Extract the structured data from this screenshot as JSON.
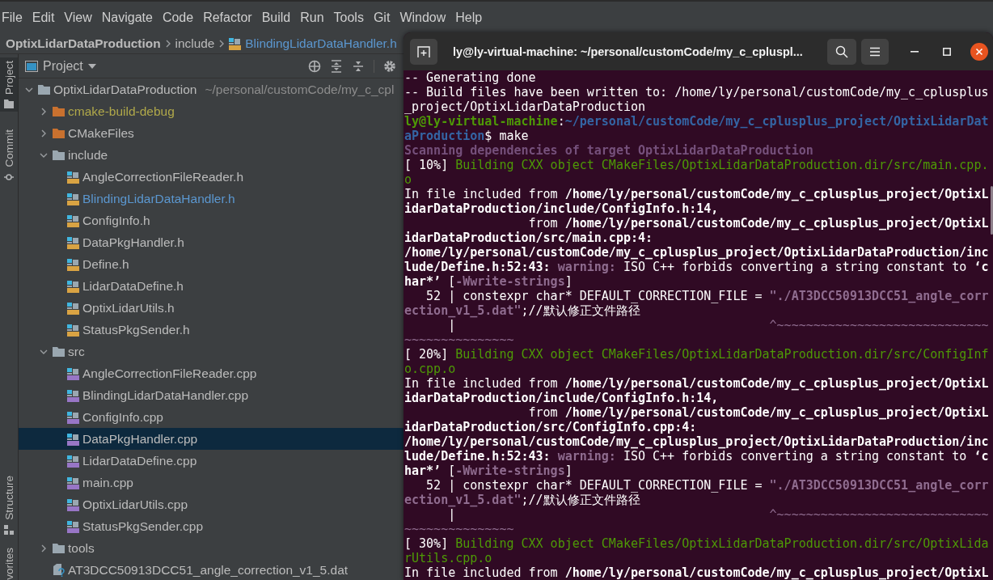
{
  "menu": [
    "File",
    "Edit",
    "View",
    "Navigate",
    "Code",
    "Refactor",
    "Build",
    "Run",
    "Tools",
    "Git",
    "Window",
    "Help"
  ],
  "breadcrumb": {
    "project": "OptixLidarDataProduction",
    "folder": "include",
    "file": "BlindingLidarDataHandler.h"
  },
  "tool_stripe": {
    "top": [
      {
        "label": "Project",
        "kind": "project",
        "selected": true
      },
      {
        "label": "Commit",
        "kind": "commit",
        "selected": false
      }
    ],
    "bottom": [
      {
        "label": "Structure",
        "kind": "structure",
        "selected": false
      },
      {
        "label": "vorites",
        "kind": "favorites",
        "selected": false
      }
    ]
  },
  "project_panel": {
    "title": "Project",
    "tree": [
      {
        "label": "OptixLidarDataProduction",
        "path": "~/personal/customCode/my_c_cpl",
        "kind": "folder",
        "color": "#9aa7b0",
        "excluded": false,
        "expanded": true,
        "selected": false,
        "children": [
          {
            "label": "cmake-build-debug",
            "kind": "folder",
            "color": "#c9712f",
            "excluded": true,
            "expanded": false,
            "selected": false
          },
          {
            "label": "CMakeFiles",
            "kind": "folder",
            "color": "#c9712f",
            "excluded": false,
            "expanded": false,
            "selected": false
          },
          {
            "label": "include",
            "kind": "folder",
            "color": "#9aa7b0",
            "excluded": false,
            "expanded": true,
            "selected": false,
            "children": [
              {
                "label": "AngleCorrectionFileReader.h",
                "kind": "header",
                "current": false,
                "selected": false
              },
              {
                "label": "BlindingLidarDataHandler.h",
                "kind": "header",
                "current": true,
                "selected": false
              },
              {
                "label": "ConfigInfo.h",
                "kind": "header",
                "current": false,
                "selected": false
              },
              {
                "label": "DataPkgHandler.h",
                "kind": "header",
                "current": false,
                "selected": false
              },
              {
                "label": "Define.h",
                "kind": "header",
                "current": false,
                "selected": false
              },
              {
                "label": "LidarDataDefine.h",
                "kind": "header",
                "current": false,
                "selected": false
              },
              {
                "label": "OptixLidarUtils.h",
                "kind": "header",
                "current": false,
                "selected": false
              },
              {
                "label": "StatusPkgSender.h",
                "kind": "header",
                "current": false,
                "selected": false
              }
            ]
          },
          {
            "label": "src",
            "kind": "folder",
            "color": "#9aa7b0",
            "excluded": false,
            "expanded": true,
            "selected": false,
            "children": [
              {
                "label": "AngleCorrectionFileReader.cpp",
                "kind": "source",
                "current": false,
                "selected": false
              },
              {
                "label": "BlindingLidarDataHandler.cpp",
                "kind": "source",
                "current": false,
                "selected": false
              },
              {
                "label": "ConfigInfo.cpp",
                "kind": "source",
                "current": false,
                "selected": false
              },
              {
                "label": "DataPkgHandler.cpp",
                "kind": "source",
                "current": false,
                "selected": true
              },
              {
                "label": "LidarDataDefine.cpp",
                "kind": "source",
                "current": false,
                "selected": false
              },
              {
                "label": "main.cpp",
                "kind": "source",
                "current": false,
                "selected": false
              },
              {
                "label": "OptixLidarUtils.cpp",
                "kind": "source",
                "current": false,
                "selected": false
              },
              {
                "label": "StatusPkgSender.cpp",
                "kind": "source",
                "current": false,
                "selected": false
              }
            ]
          },
          {
            "label": "tools",
            "kind": "folder",
            "color": "#9aa7b0",
            "excluded": false,
            "expanded": false,
            "selected": false
          },
          {
            "label": "AT3DCC50913DCC51_angle_correction_v1_5.dat",
            "kind": "data",
            "current": false,
            "selected": false
          }
        ]
      }
    ]
  },
  "terminal": {
    "title": "ly@ly-virtual-machine: ~/personal/customCode/my_c_cpluspl...",
    "lines": [
      {
        "segments": [
          {
            "kind": "plain",
            "text": "-- Generating done"
          }
        ]
      },
      {
        "segments": [
          {
            "kind": "plain",
            "text": "-- Build files have been written to: /home/ly/personal/customCode/my_c_cplusplus_project/OptixLidarDataProduction"
          }
        ]
      },
      {
        "segments": [
          {
            "kind": "prompt_user",
            "text": "ly@ly-virtual-machine"
          },
          {
            "kind": "plain",
            "text": ":"
          },
          {
            "kind": "prompt_path",
            "text": "~/personal/customCode/my_c_cplusplus_project/OptixLidarDataProduction"
          },
          {
            "kind": "plain",
            "text": "$ make"
          }
        ]
      },
      {
        "segments": [
          {
            "kind": "info",
            "text": "Scanning dependencies of target OptixLidarDataProduction"
          }
        ]
      },
      {
        "segments": [
          {
            "kind": "plain",
            "text": "[ 10%] "
          },
          {
            "kind": "progress",
            "text": "Building CXX object CMakeFiles/OptixLidarDataProduction.dir/src/main.cpp.o"
          }
        ]
      },
      {
        "segments": [
          {
            "kind": "plain",
            "text": "In file included from "
          },
          {
            "kind": "bold",
            "text": "/home/ly/personal/customCode/my_c_cplusplus_project/OptixLidarDataProduction/include/ConfigInfo.h:14,"
          }
        ]
      },
      {
        "segments": [
          {
            "kind": "plain",
            "text": "                 from "
          },
          {
            "kind": "bold",
            "text": "/home/ly/personal/customCode/my_c_cplusplus_project/OptixLidarDataProduction/src/main.cpp:4:"
          }
        ]
      },
      {
        "segments": [
          {
            "kind": "bold",
            "text": "/home/ly/personal/customCode/my_c_cplusplus_project/OptixLidarDataProduction/include/Define.h:52:43: "
          },
          {
            "kind": "warning",
            "text": "warning:"
          },
          {
            "kind": "plain",
            "text": " ISO C++ forbids converting a string constant to "
          },
          {
            "kind": "bold",
            "text": "‘char*’"
          },
          {
            "kind": "plain",
            "text": " ["
          },
          {
            "kind": "warning",
            "text": "-Wwrite-strings"
          },
          {
            "kind": "plain",
            "text": "]"
          }
        ]
      },
      {
        "segments": [
          {
            "kind": "plain",
            "text": "   52 | constexpr char* DEFAULT_CORRECTION_FILE = "
          },
          {
            "kind": "literal",
            "text": "\"./AT3DCC50913DCC51_angle_correction_v1_5.dat\""
          },
          {
            "kind": "plain",
            "text": ";//默认修正文件路径"
          }
        ]
      },
      {
        "segments": [
          {
            "kind": "plain",
            "text": "      |                                           "
          },
          {
            "kind": "marker",
            "text": "^~~~~~~~~~~~~~~~~~~~~~~~~~~~~~~~~~~~~~~~~~~~~"
          }
        ]
      },
      {
        "segments": [
          {
            "kind": "plain",
            "text": "[ 20%] "
          },
          {
            "kind": "progress",
            "text": "Building CXX object CMakeFiles/OptixLidarDataProduction.dir/src/ConfigInfo.cpp.o"
          }
        ]
      },
      {
        "segments": [
          {
            "kind": "plain",
            "text": "In file included from "
          },
          {
            "kind": "bold",
            "text": "/home/ly/personal/customCode/my_c_cplusplus_project/OptixLidarDataProduction/include/ConfigInfo.h:14,"
          }
        ]
      },
      {
        "segments": [
          {
            "kind": "plain",
            "text": "                 from "
          },
          {
            "kind": "bold",
            "text": "/home/ly/personal/customCode/my_c_cplusplus_project/OptixLidarDataProduction/src/ConfigInfo.cpp:4:"
          }
        ]
      },
      {
        "segments": [
          {
            "kind": "bold",
            "text": "/home/ly/personal/customCode/my_c_cplusplus_project/OptixLidarDataProduction/include/Define.h:52:43: "
          },
          {
            "kind": "warning",
            "text": "warning:"
          },
          {
            "kind": "plain",
            "text": " ISO C++ forbids converting a string constant to "
          },
          {
            "kind": "bold",
            "text": "‘char*’"
          },
          {
            "kind": "plain",
            "text": " ["
          },
          {
            "kind": "warning",
            "text": "-Wwrite-strings"
          },
          {
            "kind": "plain",
            "text": "]"
          }
        ]
      },
      {
        "segments": [
          {
            "kind": "plain",
            "text": "   52 | constexpr char* DEFAULT_CORRECTION_FILE = "
          },
          {
            "kind": "literal",
            "text": "\"./AT3DCC50913DCC51_angle_correction_v1_5.dat\""
          },
          {
            "kind": "plain",
            "text": ";//默认修正文件路径"
          }
        ]
      },
      {
        "segments": [
          {
            "kind": "plain",
            "text": "      |                                           "
          },
          {
            "kind": "marker",
            "text": "^~~~~~~~~~~~~~~~~~~~~~~~~~~~~~~~~~~~~~~~~~~~~"
          }
        ]
      },
      {
        "segments": [
          {
            "kind": "plain",
            "text": "[ 30%] "
          },
          {
            "kind": "progress",
            "text": "Building CXX object CMakeFiles/OptixLidarDataProduction.dir/src/OptixLidarUtils.cpp.o"
          }
        ]
      },
      {
        "segments": [
          {
            "kind": "plain",
            "text": "In file included from "
          },
          {
            "kind": "bold",
            "text": "/home/ly/personal/customCode/my_c_cplusplus_project/OptixL"
          }
        ]
      }
    ]
  }
}
